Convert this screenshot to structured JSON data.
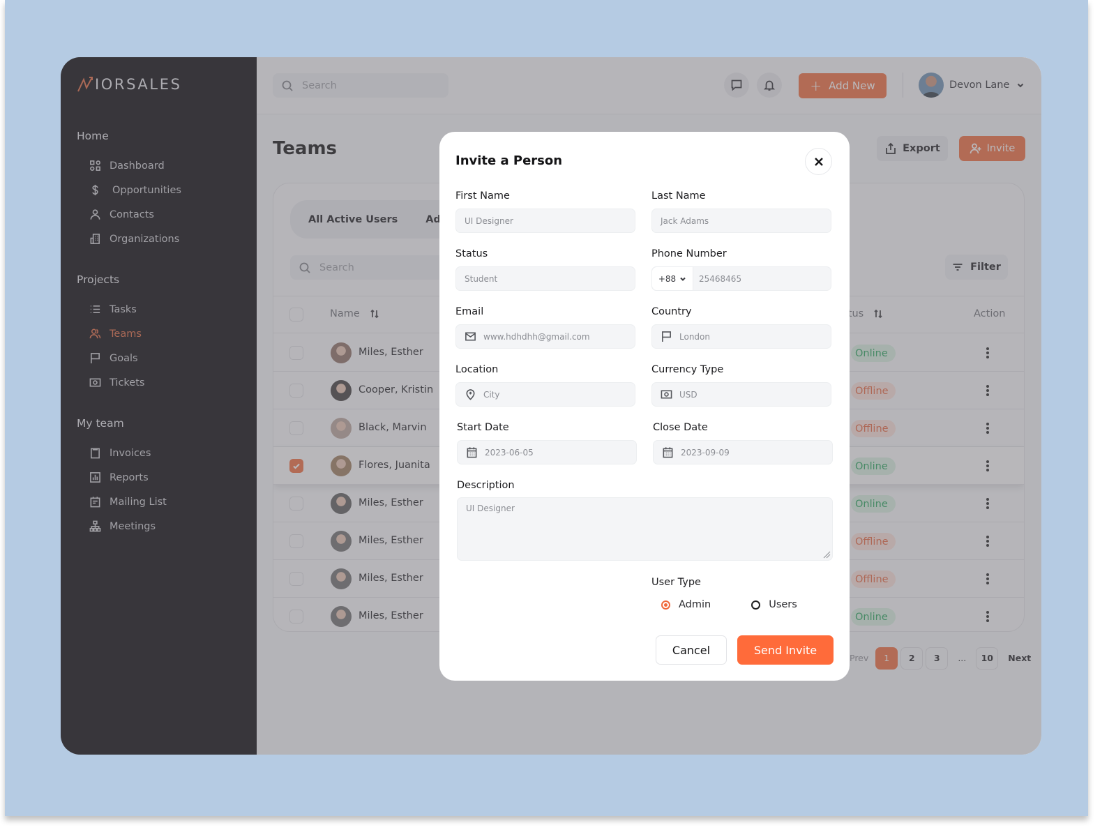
{
  "brand": {
    "name": "IORSALES",
    "accent": "#f06a3b"
  },
  "sidebar": {
    "sections": [
      {
        "heading": "Home",
        "items": [
          {
            "label": "Dashboard",
            "icon": "grid-icon"
          },
          {
            "label": "Opportunities",
            "icon": "dollar-icon"
          },
          {
            "label": "Contacts",
            "icon": "user-icon"
          },
          {
            "label": "Organizations",
            "icon": "building-icon"
          }
        ]
      },
      {
        "heading": "Projects",
        "items": [
          {
            "label": "Tasks",
            "icon": "list-icon"
          },
          {
            "label": "Teams",
            "icon": "users-icon",
            "active": true
          },
          {
            "label": "Goals",
            "icon": "flag-icon"
          },
          {
            "label": "Tickets",
            "icon": "ticket-icon"
          }
        ]
      },
      {
        "heading": "My team",
        "items": [
          {
            "label": "Invoices",
            "icon": "clipboard-icon"
          },
          {
            "label": "Reports",
            "icon": "chart-icon"
          },
          {
            "label": "Mailing List",
            "icon": "calendar-list-icon"
          },
          {
            "label": "Meetings",
            "icon": "hierarchy-icon"
          }
        ]
      }
    ]
  },
  "topbar": {
    "search_placeholder": "Search",
    "add_new_label": "Add New",
    "user_name": "Devon Lane"
  },
  "page": {
    "title": "Teams",
    "export_label": "Export",
    "invite_label": "Invite",
    "tabs": [
      "All Active Users",
      "Admin"
    ],
    "search_placeholder": "Search",
    "filter_label": "Filter",
    "columns": {
      "name": "Name",
      "status": "Status",
      "action": "Action"
    },
    "rows": [
      {
        "name": "Miles, Esther",
        "status": "Online",
        "selected": false
      },
      {
        "name": "Cooper, Kristin",
        "status": "Offline",
        "selected": false
      },
      {
        "name": "Black, Marvin",
        "status": "Offline",
        "selected": false
      },
      {
        "name": "Flores, Juanita",
        "status": "Online",
        "selected": true
      },
      {
        "name": "Miles, Esther",
        "status": "Online",
        "selected": false
      },
      {
        "name": "Miles, Esther",
        "status": "Offline",
        "selected": false
      },
      {
        "name": "Miles, Esther",
        "status": "Offline",
        "selected": false
      },
      {
        "name": "Miles, Esther",
        "status": "Online",
        "selected": false
      }
    ],
    "pagination": {
      "prev": "Prev",
      "pages": [
        "1",
        "2",
        "3"
      ],
      "ellipsis": "...",
      "last": "10",
      "next": "Next",
      "current": "1"
    }
  },
  "modal": {
    "title": "Invite a Person",
    "fields": {
      "first_name": {
        "label": "First Name",
        "value": "UI Designer"
      },
      "last_name": {
        "label": "Last Name",
        "value": "Jack Adams"
      },
      "status": {
        "label": "Status",
        "value": "Student"
      },
      "phone": {
        "label": "Phone Number",
        "code": "+88",
        "value": "25468465"
      },
      "email": {
        "label": "Email",
        "value": "www.hdhdhh@gmail.com"
      },
      "country": {
        "label": "Country",
        "value": "London"
      },
      "location": {
        "label": "Location",
        "value": "City"
      },
      "currency": {
        "label": "Currency Type",
        "value": "USD"
      },
      "start_date": {
        "label": "Start Date",
        "value": "2023-06-05"
      },
      "close_date": {
        "label": "Close Date",
        "value": "2023-09-09"
      },
      "description": {
        "label": "Description",
        "value": "UI Designer"
      }
    },
    "user_type": {
      "label": "User Type",
      "options": [
        "Admin",
        "Users"
      ],
      "selected": "Admin"
    },
    "cancel_label": "Cancel",
    "send_label": "Send Invite"
  },
  "colors": {
    "online_text": "#26a55a",
    "offline_text": "#e8653d",
    "sidebar_bg": "#060509",
    "canvas_bg": "#b5cbe3"
  }
}
